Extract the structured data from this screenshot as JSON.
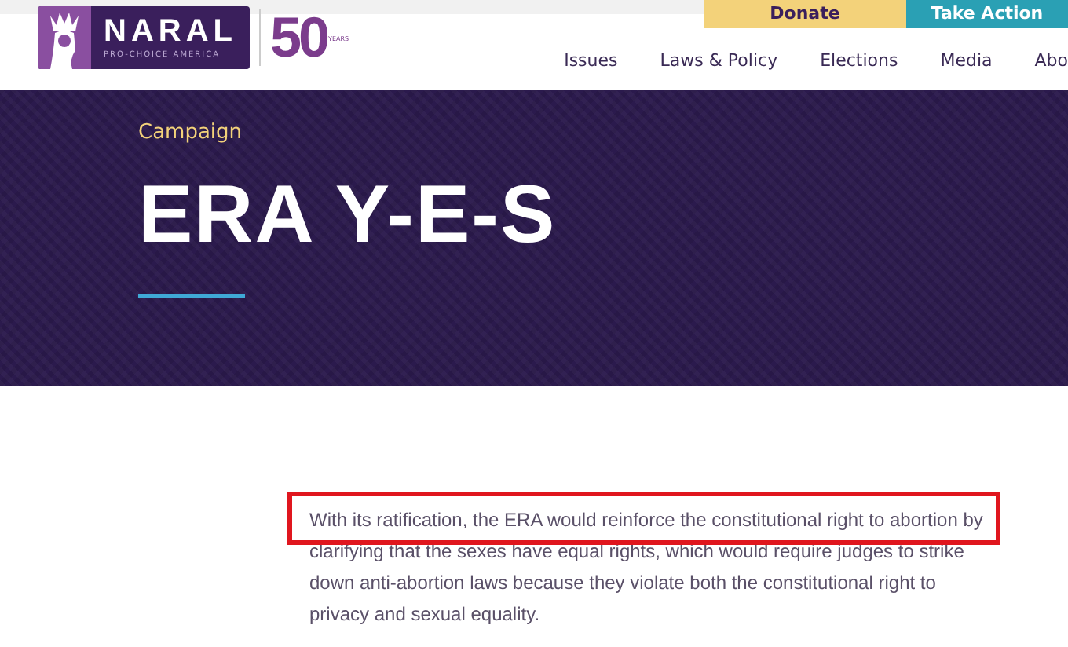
{
  "top_buttons": [
    {
      "label": "Donate",
      "kind": "donate"
    },
    {
      "label": "Take Action",
      "kind": "action"
    }
  ],
  "logo": {
    "name": "NARAL",
    "tagline": "PRO-CHOICE AMERICA",
    "anniversary": "50",
    "anniversary_unit": "YEARS"
  },
  "nav": [
    {
      "label": "Issues"
    },
    {
      "label": "Laws & Policy"
    },
    {
      "label": "Elections"
    },
    {
      "label": "Media"
    },
    {
      "label": "Abo"
    }
  ],
  "hero": {
    "eyebrow": "Campaign",
    "title": "ERA Y-E-S"
  },
  "body": {
    "paragraph": "With its ratification, the ERA would reinforce the constitutional right to abortion by clarifying that the sexes have equal rights, which would require judges to strike down anti-abortion laws because they violate both the constitutional right to privacy and sexual equality.",
    "first_line_highlighted": true
  }
}
